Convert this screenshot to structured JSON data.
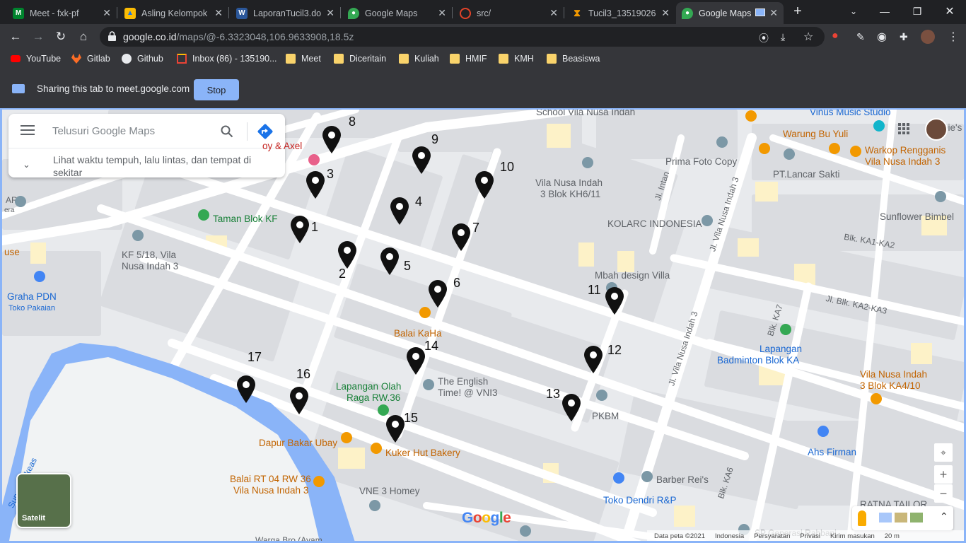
{
  "browser": {
    "tabs": [
      {
        "title": "Meet - fxk-pf",
        "favicon": "meet-icon",
        "active": false
      },
      {
        "title": "Asling Kelompok",
        "favicon": "drive-icon",
        "active": false
      },
      {
        "title": "LaporanTucil3.do",
        "favicon": "word-icon",
        "active": false
      },
      {
        "title": "Google Maps",
        "favicon": "maps-icon",
        "active": false
      },
      {
        "title": "src/",
        "favicon": "gitlab-icon",
        "active": false
      },
      {
        "title": "Tucil3_13519026",
        "favicon": "hourglass-icon",
        "active": false
      },
      {
        "title": "Google Maps",
        "favicon": "maps-icon",
        "active": true
      }
    ],
    "url_host": "google.co.id",
    "url_path": "/maps/@-6.3323048,106.9633908,18.5z",
    "bookmarks": [
      {
        "label": "YouTube",
        "icon": "youtube-icon"
      },
      {
        "label": "Gitlab",
        "icon": "gitlab-icon"
      },
      {
        "label": "Github",
        "icon": "github-icon"
      },
      {
        "label": "Inbox (86) - 135190...",
        "icon": "gmail-icon"
      },
      {
        "label": "Meet",
        "icon": "folder-icon"
      },
      {
        "label": "Diceritain",
        "icon": "folder-icon"
      },
      {
        "label": "Kuliah",
        "icon": "folder-icon"
      },
      {
        "label": "HMIF",
        "icon": "folder-icon"
      },
      {
        "label": "KMH",
        "icon": "folder-icon"
      },
      {
        "label": "Beasiswa",
        "icon": "folder-icon"
      }
    ]
  },
  "share_bar": {
    "text": "Sharing this tab to meet.google.com",
    "stop_label": "Stop"
  },
  "maps": {
    "search_placeholder": "Telusuri Google Maps",
    "hint": "Lihat waktu tempuh, lalu lintas, dan tempat di sekitar",
    "satellite_label": "Satelit",
    "logo": "Google",
    "footer": [
      "Data peta ©2021",
      "Indonesia",
      "Persyaratan",
      "Privasi",
      "Kirim masukan",
      "20 m"
    ],
    "markers": [
      "1",
      "2",
      "3",
      "4",
      "5",
      "6",
      "7",
      "8",
      "9",
      "10",
      "11",
      "12",
      "13",
      "14",
      "15",
      "16",
      "17"
    ],
    "places": {
      "school": "School Vila Nusa Indah",
      "vinus": "Vinus Music Studio",
      "warung": "Warung Bu Yuli",
      "warkop1": "Warkop Rengganis",
      "warkop2": "Vila Nusa Indah 3",
      "prima": "Prima Foto Copy",
      "lancar": "PT.Lancar Sakti",
      "vni_kh1": "Vila Nusa Indah",
      "vni_kh2": "3 Blok KH6/11",
      "sunflower": "Sunflower Bimbel",
      "taman": "Taman Blok KF",
      "kolarc": "KOLARC INDONESIA",
      "kf1": "KF 5/18, Vila",
      "kf2": "Nusa Indah 3",
      "graha": "Graha PDN",
      "graha_sub": "Toko Pakaian",
      "mbah": "Mbah design Villa",
      "balai_kaha": "Balai KaHa",
      "lapangan_b1": "Lapangan",
      "lapangan_b2": "Badminton Blok KA",
      "english1": "The English",
      "english2": "Time! @ VNI3",
      "lap_olah1": "Lapangan Olah",
      "lap_olah2": "Raga RW.36",
      "vni_ka1": "Vila Nusa Indah",
      "vni_ka2": "3 Blok KA4/10",
      "pkbm": "PKBM",
      "dapur": "Dapur Bakar Ubay",
      "kuker": "Kuker Hut Bakery",
      "ahs": "Ahs Firman",
      "balai_rt1": "Balai RT 04 RW 36",
      "balai_rt2": "Vila Nusa Indah 3",
      "barber": "Barber Rei's",
      "toko_dendri": "Toko Dendri R&P",
      "vne": "VNE 3 Homey",
      "ratna": "RATNA TAILOR",
      "sp": "SP Generasi Rabbani",
      "warga": "Warga Bro (Ayam",
      "hotel_frag": "oy & Axel",
      "ar_frag": "AR",
      "era_frag": "era",
      "use_frag": "use",
      "bies_frag": "bie's"
    },
    "streets": {
      "intan": "Jl. Intan",
      "vni3_a": "Jl. Vila Nusa Indah 3",
      "vni3_b": "Jl. Vila Nusa Indah 3",
      "ka1_ka2": "Blk. KA1-KA2",
      "ka2_ka3": "Jl. Blk. KA2-KA3",
      "ka7": "Blk. KA7",
      "ka6": "Blk. KA6",
      "sungai": "Sungai Cikeas"
    }
  }
}
